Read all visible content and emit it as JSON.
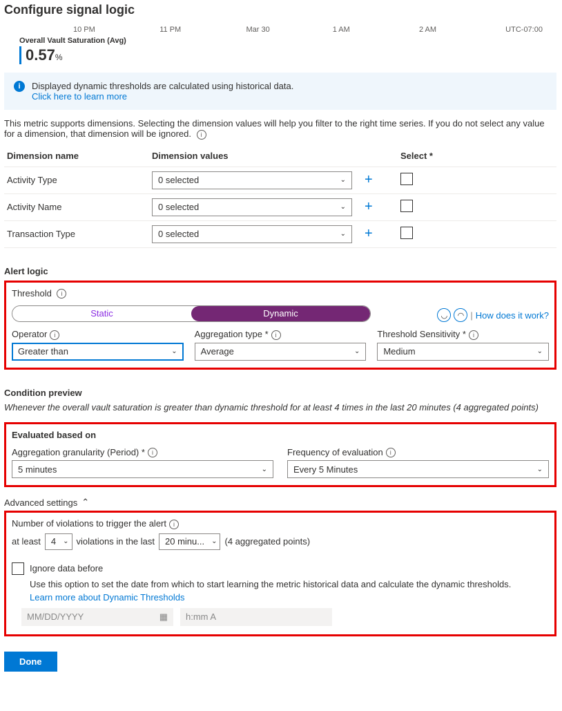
{
  "title": "Configure signal logic",
  "timeline": {
    "t1": "10 PM",
    "t2": "11 PM",
    "t3": "Mar 30",
    "t4": "1 AM",
    "t5": "2 AM",
    "utc": "UTC-07:00"
  },
  "metric": {
    "name": "Overall Vault Saturation (Avg)",
    "value": "0.57",
    "unit": "%"
  },
  "banner": {
    "text": "Displayed dynamic thresholds are calculated using historical data.",
    "link": "Click here to learn more"
  },
  "dimensions": {
    "intro": "This metric supports dimensions. Selecting the dimension values will help you filter to the right time series. If you do not select any value for a dimension, that dimension will be ignored.",
    "headers": {
      "name": "Dimension name",
      "values": "Dimension values",
      "select": "Select *"
    },
    "rows": [
      {
        "name": "Activity Type",
        "value": "0 selected"
      },
      {
        "name": "Activity Name",
        "value": "0 selected"
      },
      {
        "name": "Transaction Type",
        "value": "0 selected"
      }
    ]
  },
  "alert_logic": {
    "heading": "Alert logic",
    "threshold_label": "Threshold",
    "static": "Static",
    "dynamic": "Dynamic",
    "how": "How does it work?",
    "operator": {
      "label": "Operator",
      "value": "Greater than"
    },
    "aggtype": {
      "label": "Aggregation type *",
      "value": "Average"
    },
    "sensitivity": {
      "label": "Threshold Sensitivity *",
      "value": "Medium"
    }
  },
  "preview": {
    "heading": "Condition preview",
    "text": "Whenever the overall vault saturation is greater than dynamic threshold for at least 4 times in the last 20 minutes (4 aggregated points)"
  },
  "evaluated": {
    "heading": "Evaluated based on",
    "period": {
      "label": "Aggregation granularity (Period) *",
      "value": "5 minutes"
    },
    "freq": {
      "label": "Frequency of evaluation",
      "value": "Every 5 Minutes"
    }
  },
  "advanced": {
    "heading": "Advanced settings",
    "violations_label": "Number of violations to trigger the alert",
    "at_least": "at least",
    "count": "4",
    "middle": "violations in the last",
    "window": "20 minu...",
    "points": "(4 aggregated points)",
    "ignore_label": "Ignore data before",
    "ignore_desc": "Use this option to set the date from which to start learning the metric historical data and calculate the dynamic thresholds.",
    "learn_link": "Learn more about Dynamic Thresholds",
    "date_ph": "MM/DD/YYYY",
    "time_ph": "h:mm A"
  },
  "done": "Done"
}
